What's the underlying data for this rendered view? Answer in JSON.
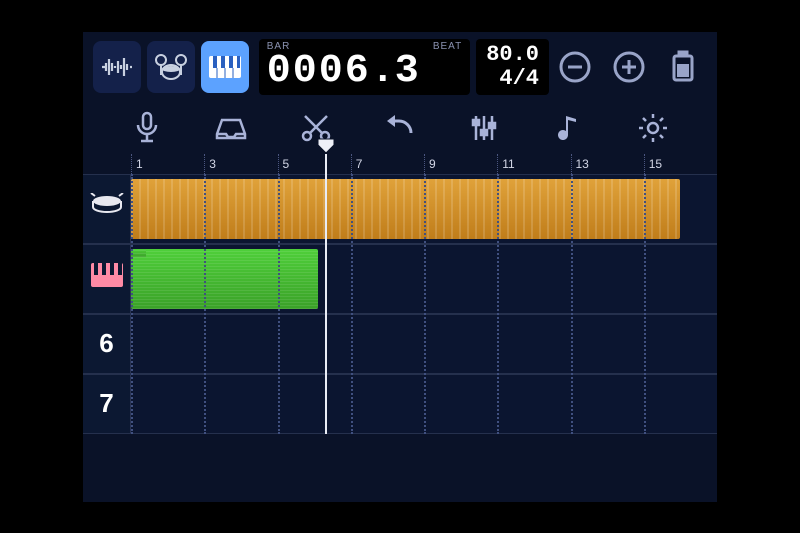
{
  "counter": {
    "bar_label": "BAR",
    "beat_label": "BEAT",
    "bar_value": "0006",
    "beat_value": "3"
  },
  "tempo": {
    "bpm": "80.0",
    "signature": "4/4"
  },
  "ruler_ticks": [
    "1",
    "3",
    "5",
    "7",
    "9",
    "11",
    "13",
    "15"
  ],
  "tracks": {
    "drums": {
      "clip_start_bar": 1,
      "clip_end_bar": 16
    },
    "keys": {
      "clip_start_bar": 1,
      "clip_end_bar": 6.1,
      "tail_bar": 1.4
    },
    "empty": [
      {
        "label": "6"
      },
      {
        "label": "7"
      }
    ]
  },
  "playhead_bar": 6.3
}
